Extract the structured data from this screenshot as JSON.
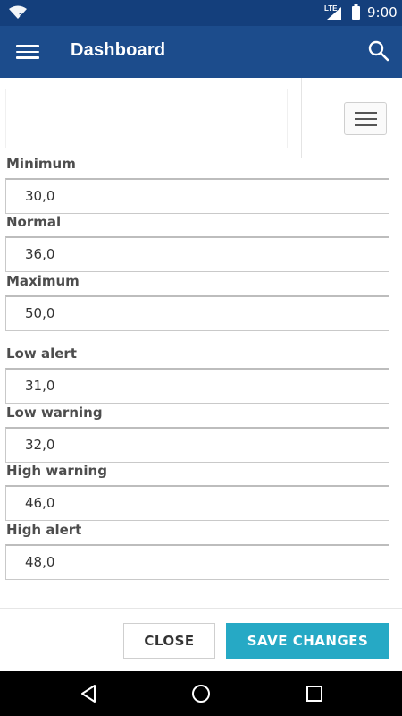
{
  "status_bar": {
    "network_label": "LTE",
    "time": "9:00",
    "icons": [
      "wifi-icon",
      "signal-icon",
      "battery-icon"
    ]
  },
  "app_bar": {
    "title": "Dashboard",
    "menu_icon": "menu-icon",
    "search_icon": "search-icon"
  },
  "toolbar": {
    "list_toggle_icon": "hamburger-icon"
  },
  "form": {
    "fields": [
      {
        "label": "Minimum",
        "value": "30,0"
      },
      {
        "label": "Normal",
        "value": "36,0"
      },
      {
        "label": "Maximum",
        "value": "50,0"
      },
      {
        "label": "Low alert",
        "value": "31,0"
      },
      {
        "label": "Low warning",
        "value": "32,0"
      },
      {
        "label": "High warning",
        "value": "46,0"
      },
      {
        "label": "High alert",
        "value": "48,0"
      }
    ]
  },
  "footer": {
    "close_label": "CLOSE",
    "save_label": "SAVE CHANGES"
  },
  "colors": {
    "status_bar": "#143f7c",
    "app_bar": "#1c4c8c",
    "save_button": "#26a9c5"
  },
  "nav_bar": {
    "icons": [
      "back-icon",
      "home-icon",
      "recents-icon"
    ]
  }
}
